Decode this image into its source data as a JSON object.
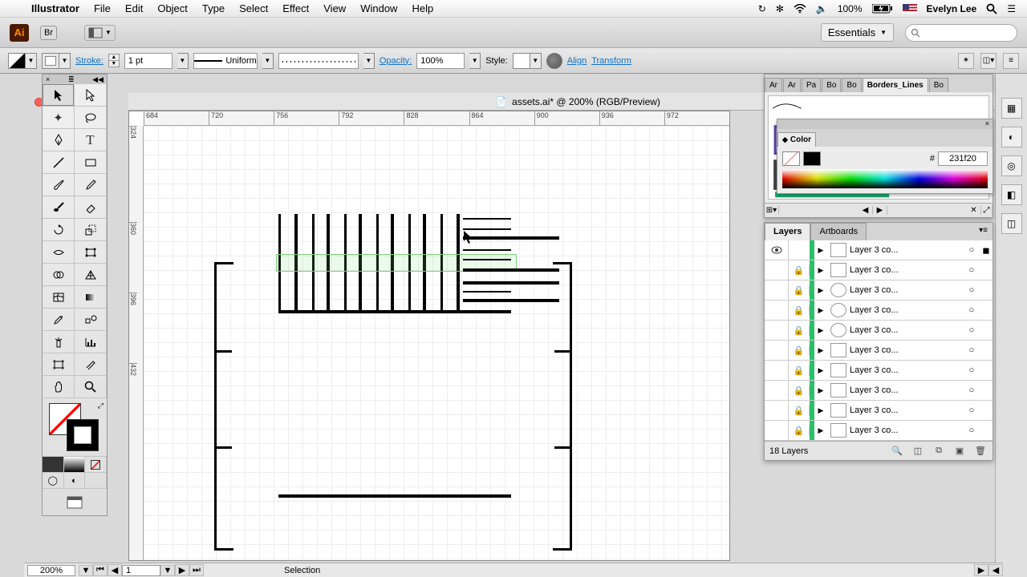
{
  "os_menu": {
    "app": "Illustrator",
    "items": [
      "File",
      "Edit",
      "Object",
      "Type",
      "Select",
      "Effect",
      "View",
      "Window",
      "Help"
    ],
    "battery": "100%",
    "user": "Evelyn Lee"
  },
  "app_bar": {
    "br_tab": "Br",
    "workspace": "Essentials"
  },
  "control_bar": {
    "stroke_label": "Stroke:",
    "stroke_weight": "1 pt",
    "stroke_profile": "Uniform",
    "opacity_label": "Opacity:",
    "opacity_value": "100%",
    "style_label": "Style:",
    "align_link": "Align",
    "transform_link": "Transform"
  },
  "document": {
    "title": "assets.ai* @ 200% (RGB/Preview)",
    "ruler_marks": [
      "684",
      "720",
      "756",
      "792",
      "828",
      "864",
      "900",
      "936",
      "972"
    ],
    "vruler_marks": [
      "324",
      "360",
      "396",
      "432"
    ]
  },
  "panels": {
    "brush_tabs": [
      "Ar",
      "Ar",
      "Pa",
      "Bo",
      "Bo",
      "Borders_Lines",
      "Bo"
    ],
    "color": {
      "title": "Color",
      "hex": "231f20",
      "hash": "#"
    },
    "layers_tabs": [
      "Layers",
      "Artboards"
    ],
    "layers": [
      {
        "name": "Layer 3 co...",
        "visible": true,
        "locked": false,
        "selected": true
      },
      {
        "name": "Layer 3 co...",
        "locked": true
      },
      {
        "name": "Layer 3 co...",
        "locked": true
      },
      {
        "name": "Layer 3 co...",
        "locked": true
      },
      {
        "name": "Layer 3 co...",
        "locked": true
      },
      {
        "name": "Layer 3 co...",
        "locked": true
      },
      {
        "name": "Layer 3 co...",
        "locked": true
      },
      {
        "name": "Layer 3 co...",
        "locked": true
      },
      {
        "name": "Layer 3 co...",
        "locked": true
      },
      {
        "name": "Layer 3 co...",
        "locked": true
      }
    ],
    "layers_footer": "18 Layers"
  },
  "status": {
    "zoom": "200%",
    "page": "1",
    "mode": "Selection"
  }
}
